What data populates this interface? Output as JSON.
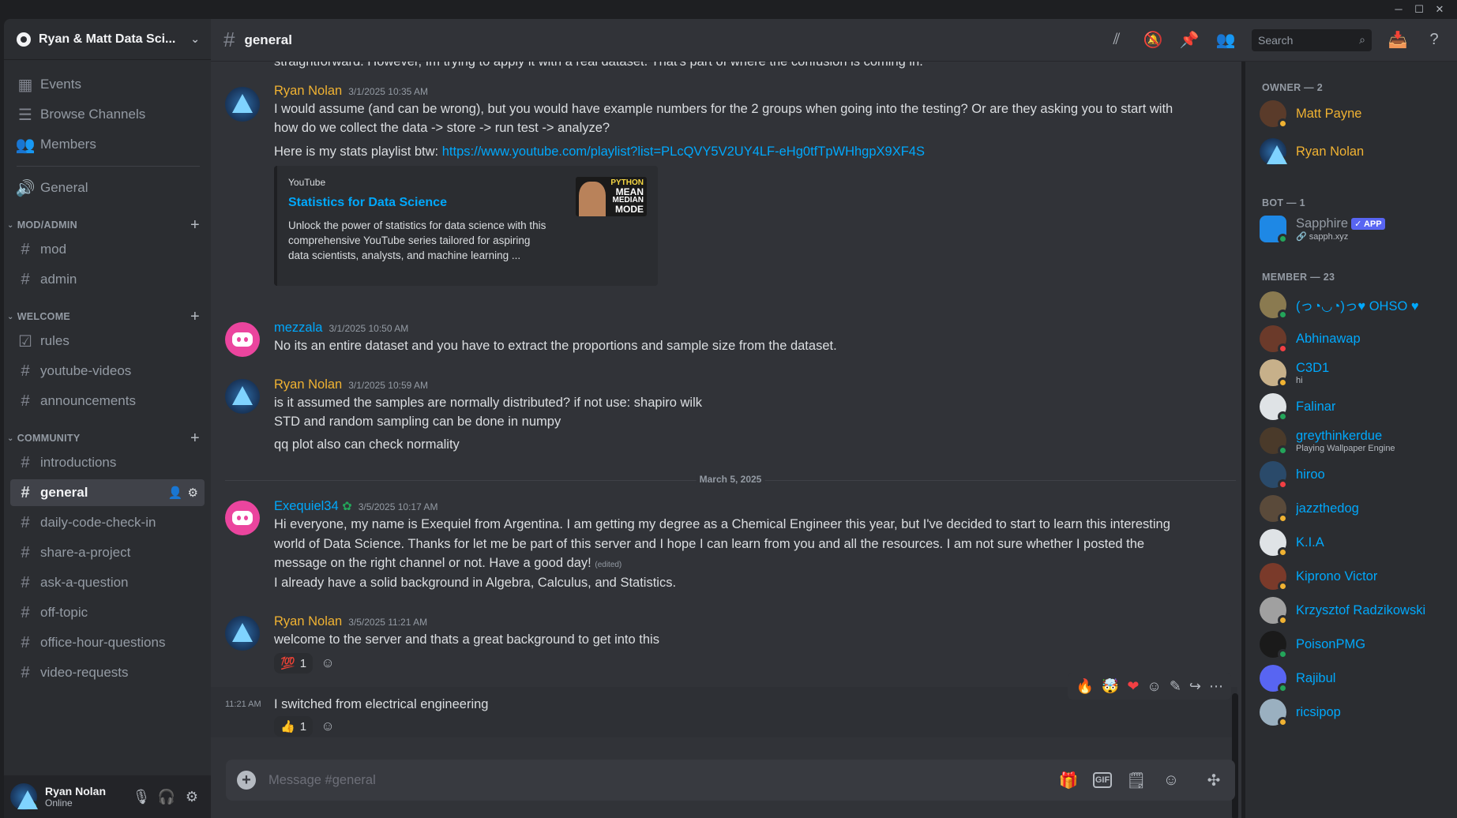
{
  "window": {
    "minimize": "─",
    "maximize": "☐",
    "close": "✕"
  },
  "server": {
    "name": "Ryan & Matt Data Sci..."
  },
  "sidebar": {
    "top_items": [
      {
        "label": "Events",
        "icon": "calendar-icon"
      },
      {
        "label": "Browse Channels",
        "icon": "browse-channels-icon"
      },
      {
        "label": "Members",
        "icon": "members-icon"
      }
    ],
    "general_voice": "General",
    "categories": [
      {
        "name": "MOD/ADMIN",
        "channels": [
          "mod",
          "admin"
        ]
      },
      {
        "name": "WELCOME",
        "channels": [
          "rules",
          "youtube-videos",
          "announcements"
        ]
      },
      {
        "name": "COMMUNITY",
        "channels": [
          "introductions",
          "general",
          "daily-code-check-in",
          "share-a-project",
          "ask-a-question",
          "off-topic",
          "office-hour-questions",
          "video-requests"
        ]
      }
    ],
    "active_channel": "general"
  },
  "user": {
    "name": "Ryan Nolan",
    "status": "Online"
  },
  "channel": {
    "name": "general"
  },
  "search": {
    "placeholder": "Search"
  },
  "messages": {
    "continuation": "straightforward. However,  Im trying to apply it with a real dataset. That's part of where the confusion is coming in.",
    "m1": {
      "author": "Ryan Nolan",
      "time": "3/1/2025 10:35 AM",
      "line1": "I would assume (and can be wrong), but you would have example numbers for the 2 groups when going into the testing? Or are they asking you to start with",
      "line2": "how do we collect the data -> store -> run test -> analyze?",
      "line3_prefix": "Here is my stats playlist btw: ",
      "link": "https://www.youtube.com/playlist?list=PLcQVY5V2UY4LF-eHg0tfTpWHhgpX9XF4S",
      "embed": {
        "provider": "YouTube",
        "title": "Statistics for Data Science",
        "description": "Unlock the power of statistics for data science with this comprehensive YouTube series tailored for aspiring data scientists, analysts, and machine learning ...",
        "thumb_text": [
          "PYTHON",
          "MEAN",
          "MEDIAN",
          "MODE"
        ]
      }
    },
    "m2": {
      "author": "mezzala",
      "time": "3/1/2025 10:50 AM",
      "line1": "No its an entire dataset and you have to extract the proportions and sample size from the dataset."
    },
    "m3": {
      "author": "Ryan Nolan",
      "time": "3/1/2025 10:59 AM",
      "line1": "is it assumed the samples are normally distributed? if not use: shapiro wilk",
      "line2": "STD and random sampling can be done in numpy",
      "line3": "qq plot also can check normality"
    },
    "date_divider": "March 5, 2025",
    "m4": {
      "author": "Exequiel34",
      "time": "3/5/2025 10:17 AM",
      "line1": "Hi everyone, my name is Exequiel from Argentina. I am getting my degree as a Chemical Engineer this year, but I've decided to start to learn this interesting",
      "line2": "world of Data Science. Thanks for let me be part of this server and I hope I can learn from you and all the resources. I am not sure whether I posted the",
      "line3": "message on the right channel or not. Have a good day!",
      "edited": "(edited)",
      "line4": "I already have a solid background in Algebra, Calculus, and Statistics."
    },
    "m5": {
      "author": "Ryan Nolan",
      "time": "3/5/2025 11:21 AM",
      "line1": "welcome to the server and thats a great background to get into this",
      "reaction": {
        "emoji": "💯",
        "count": "1"
      }
    },
    "m6": {
      "time": "11:21 AM",
      "line1": "I switched from electrical engineering",
      "reaction": {
        "emoji": "👍",
        "count": "1"
      },
      "quick_reactions": [
        "🔥",
        "🤯",
        "❤"
      ]
    }
  },
  "composer": {
    "placeholder": "Message #general"
  },
  "members": {
    "owner_header": "OWNER — 2",
    "owners": [
      {
        "name": "Matt Payne",
        "color": "#f0b232"
      },
      {
        "name": "Ryan Nolan",
        "color": "#f0b232"
      }
    ],
    "bot_header": "BOT — 1",
    "bot": {
      "name": "Sapphire",
      "badge": "APP",
      "sub": "sapph.xyz"
    },
    "member_header": "MEMBER — 23",
    "list": [
      {
        "name": "(っ◔◡◔)っ♥ OHSO ♥",
        "sub": "",
        "status": "online"
      },
      {
        "name": "Abhinawap",
        "sub": "",
        "status": "dnd"
      },
      {
        "name": "C3D1",
        "sub": "hi",
        "status": "idle"
      },
      {
        "name": "Falinar",
        "sub": "",
        "status": "online"
      },
      {
        "name": "greythinkerdue",
        "sub": "Playing Wallpaper Engine",
        "status": "online"
      },
      {
        "name": "hiroo",
        "sub": "",
        "status": "dnd"
      },
      {
        "name": "jazzthedog",
        "sub": "",
        "status": "idle"
      },
      {
        "name": "K.I.A",
        "sub": "",
        "status": "idle"
      },
      {
        "name": "Kiprono Victor",
        "sub": "",
        "status": "idle"
      },
      {
        "name": "Krzysztof Radzikowski",
        "sub": "",
        "status": "idle"
      },
      {
        "name": "PoisonPMG",
        "sub": "",
        "status": "online"
      },
      {
        "name": "Rajibul",
        "sub": "",
        "status": "online"
      },
      {
        "name": "ricsipop",
        "sub": "",
        "status": "idle"
      }
    ]
  },
  "colors": {
    "accent": "#5865f2",
    "owner_name": "#f0b232",
    "member_name": "#00a8fc",
    "online": "#23a55a",
    "idle": "#f0b232",
    "dnd": "#f23f43"
  }
}
